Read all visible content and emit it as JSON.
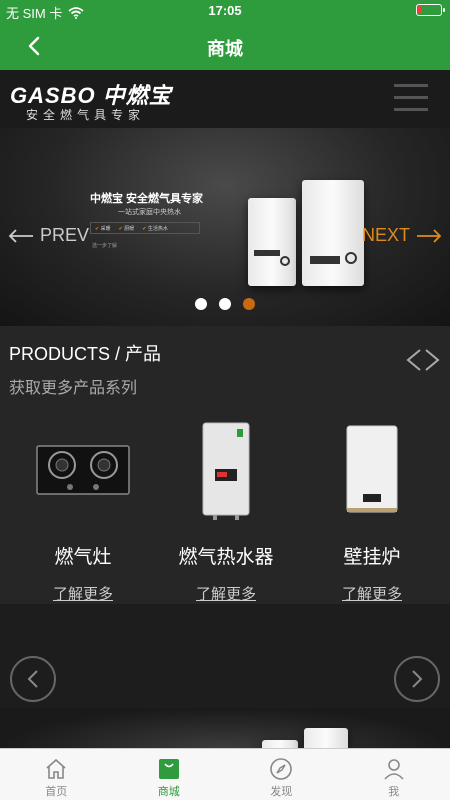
{
  "status_bar": {
    "carrier": "无 SIM 卡",
    "time": "17:05",
    "battery_level": 0.15
  },
  "nav": {
    "title": "商城"
  },
  "banner": {
    "logo_text": "GASBO 中燃宝",
    "logo_tagline": "安全燃气具专家",
    "slogan": "中燃宝 安全燃气具专家",
    "subslogan": "一站式家庭中央热水",
    "features": [
      "采暖",
      "厨暖",
      "生活热水"
    ],
    "note": "选一步了解",
    "prev_label": "PREV",
    "next_label": "NEXT",
    "slide_count": 3,
    "active_slide": 3
  },
  "products": {
    "title": "PRODUCTS / 产品",
    "subtitle": "获取更多产品系列",
    "items": [
      {
        "name": "燃气灶",
        "link": "了解更多"
      },
      {
        "name": "燃气热水器",
        "link": "了解更多"
      },
      {
        "name": "壁挂炉",
        "link": "了解更多"
      }
    ]
  },
  "tabbar": {
    "items": [
      {
        "label": "首页",
        "icon": "home-icon"
      },
      {
        "label": "商城",
        "icon": "shop-bag-icon"
      },
      {
        "label": "发现",
        "icon": "compass-icon"
      },
      {
        "label": "我",
        "icon": "person-icon"
      }
    ],
    "active": "商城"
  },
  "colors": {
    "brand_green": "#2e9b3c",
    "accent_orange": "#e08a1e",
    "active_dot": "#c86a14"
  }
}
